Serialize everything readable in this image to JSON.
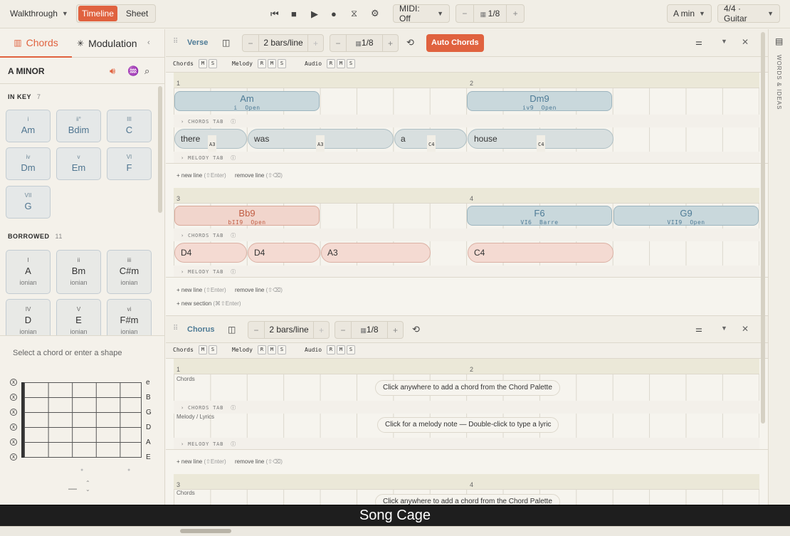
{
  "topbar": {
    "walkthrough": "Walkthrough",
    "timeline": "Timeline",
    "sheet": "Sheet",
    "midi": "MIDI: Off",
    "grid_value": "1/8",
    "key": "A min",
    "meter": "4/4 · Guitar"
  },
  "left": {
    "tab_chords": "Chords",
    "tab_modulation": "Modulation",
    "key_title": "A MINOR",
    "in_key_label": "IN KEY",
    "in_key_count": "7",
    "in_key": [
      {
        "roman": "i",
        "name": "Am"
      },
      {
        "roman": "ii°",
        "name": "Bdim"
      },
      {
        "roman": "III",
        "name": "C"
      },
      {
        "roman": "iv",
        "name": "Dm"
      },
      {
        "roman": "v",
        "name": "Em"
      },
      {
        "roman": "VI",
        "name": "F"
      },
      {
        "roman": "VII",
        "name": "G"
      }
    ],
    "borrowed_label": "BORROWED",
    "borrowed_count": "11",
    "borrowed": [
      {
        "roman": "I",
        "name": "A",
        "mode": "ionian"
      },
      {
        "roman": "ii",
        "name": "Bm",
        "mode": "ionian"
      },
      {
        "roman": "iii",
        "name": "C#m",
        "mode": "ionian"
      },
      {
        "roman": "IV",
        "name": "D",
        "mode": "ionian"
      },
      {
        "roman": "V",
        "name": "E",
        "mode": "ionian"
      },
      {
        "roman": "vi",
        "name": "F#m",
        "mode": "ionian"
      }
    ],
    "select_hint": "Select a chord or enter a shape",
    "strings": [
      "e",
      "B",
      "G",
      "D",
      "A",
      "E"
    ],
    "mute": "x",
    "dash": "—"
  },
  "verse": {
    "name": "Verse",
    "bars": "2 bars/line",
    "grid": "1/8",
    "auto_chords": "Auto Chords",
    "tracks": {
      "chords": "Chords",
      "melody": "Melody",
      "audio": "Audio",
      "m": "M",
      "s": "S",
      "r": "R"
    },
    "bar1": "1",
    "bar2": "2",
    "bar3": "3",
    "bar4": "4",
    "chords_tab": "CHORDS TAB",
    "melody_tab": "MELODY TAB",
    "line1_chords": [
      {
        "name": "Am",
        "roman": "i",
        "voicing": "Open"
      },
      {
        "name": "Dm9",
        "roman": "iv9",
        "voicing": "Open"
      }
    ],
    "line1_lyrics": [
      {
        "text": "there",
        "note": "A3"
      },
      {
        "text": "was",
        "note": "A3"
      },
      {
        "text": "a",
        "note": "C4"
      },
      {
        "text": "house",
        "note": "C4"
      }
    ],
    "line2_chords": [
      {
        "name": "Bb9",
        "roman": "bII9",
        "voicing": "Open"
      },
      {
        "name": "F6",
        "roman": "VI6",
        "voicing": "Barre"
      },
      {
        "name": "G9",
        "roman": "VII9",
        "voicing": "Open"
      }
    ],
    "line2_notes": [
      "D4",
      "D4",
      "A3",
      "C4"
    ],
    "new_line": "+ new line",
    "new_line_key": "(⇧Enter)",
    "remove_line": "remove line",
    "remove_line_key": "(⇧⌫)",
    "new_section": "+ new section",
    "new_section_key": "(⌘⇧Enter)"
  },
  "chorus": {
    "name": "Chorus",
    "bars": "2 bars/line",
    "grid": "1/8",
    "bar1": "1",
    "bar2": "2",
    "bar3": "3",
    "bar4": "4",
    "chords_label": "Chords",
    "melody_label": "Melody / Lyrics",
    "chord_hint": "Click anywhere to add a chord from the Chord Palette",
    "melody_hint": "Click for a melody note — Double-click to type a lyric"
  },
  "rightbar": {
    "label": "WORDS & IDEAS"
  },
  "caption": "Song Cage",
  "colors": {
    "accent": "#e0623f",
    "chord_blue": "#c9d8dc",
    "chord_red": "#f1d5cc"
  }
}
